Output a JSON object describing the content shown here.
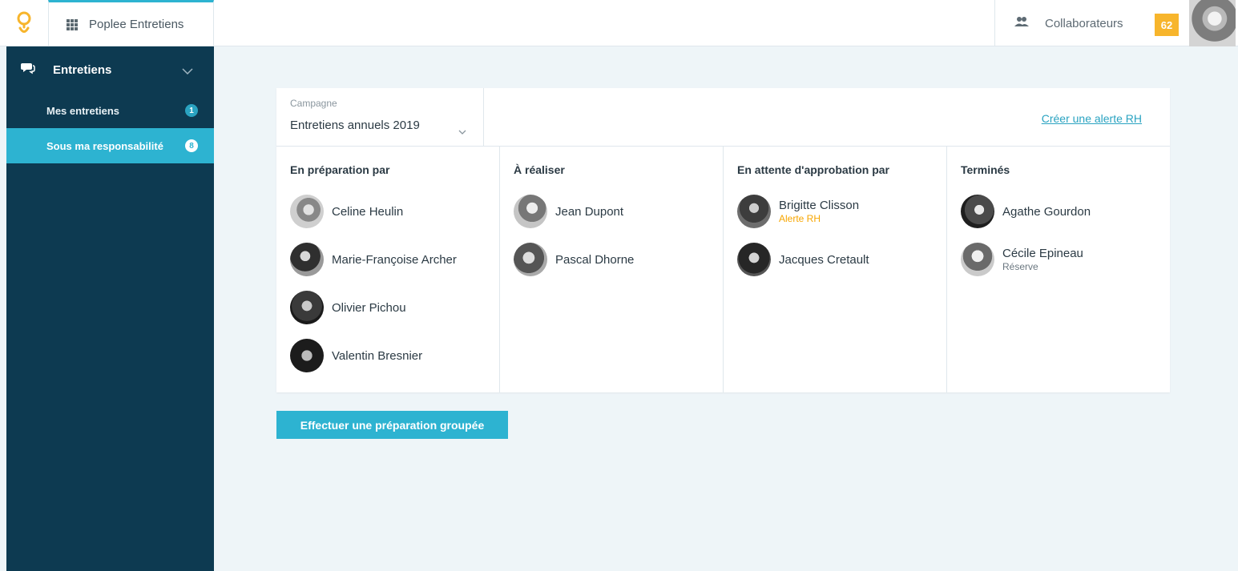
{
  "header": {
    "app_name": "Poplee Entretiens",
    "collaborators_label": "Collaborateurs",
    "score": "62",
    "accent_color": "#2db3d1",
    "logo_color": "#f7b52c"
  },
  "sidebar": {
    "section_label": "Entretiens",
    "items": [
      {
        "label": "Mes entretiens",
        "count": "1",
        "active": false
      },
      {
        "label": "Sous ma responsabilité",
        "count": "8",
        "active": true
      }
    ],
    "background_color": "#0d3a51"
  },
  "campaign": {
    "label": "Campagne",
    "value": "Entretiens annuels 2019"
  },
  "hr_alert_link": "Créer une alerte RH",
  "columns": [
    {
      "title": "En préparation par",
      "people": [
        {
          "name": "Celine Heulin",
          "status": ""
        },
        {
          "name": "Marie-Françoise Archer",
          "status": ""
        },
        {
          "name": "Olivier Pichou",
          "status": ""
        },
        {
          "name": "Valentin Bresnier",
          "status": ""
        }
      ]
    },
    {
      "title": "À réaliser",
      "people": [
        {
          "name": "Jean Dupont",
          "status": ""
        },
        {
          "name": "Pascal Dhorne",
          "status": ""
        }
      ]
    },
    {
      "title": "En attente d'approbation par",
      "people": [
        {
          "name": "Brigitte Clisson",
          "status": "Alerte RH"
        },
        {
          "name": "Jacques Cretault",
          "status": ""
        }
      ]
    },
    {
      "title": "Terminés",
      "people": [
        {
          "name": "Agathe Gourdon",
          "status": ""
        },
        {
          "name": "Cécile Epineau",
          "status": "Réserve"
        }
      ]
    }
  ],
  "group_button_label": "Effectuer une préparation groupée"
}
